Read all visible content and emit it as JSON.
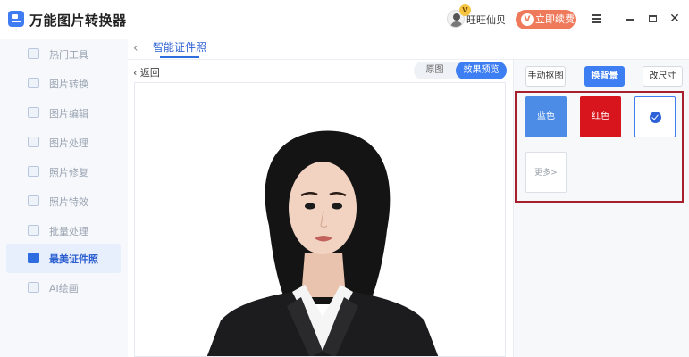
{
  "app": {
    "title": "万能图片转换器"
  },
  "header": {
    "vip_badge": "V",
    "user_name": "旺旺仙贝",
    "renew_label": "立即续费",
    "renew_icon": "V"
  },
  "sidebar": {
    "items": [
      {
        "label": "热门工具",
        "icon": "hot-tools-icon",
        "active": false
      },
      {
        "label": "图片转换",
        "icon": "image-convert-icon",
        "active": false
      },
      {
        "label": "图片编辑",
        "icon": "image-edit-icon",
        "active": false
      },
      {
        "label": "图片处理",
        "icon": "image-process-icon",
        "active": false
      },
      {
        "label": "照片修复",
        "icon": "photo-repair-icon",
        "active": false
      },
      {
        "label": "照片特效",
        "icon": "photo-effects-icon",
        "active": false
      },
      {
        "label": "批量处理",
        "icon": "batch-icon",
        "active": false
      },
      {
        "label": "最美证件照",
        "icon": "id-photo-icon",
        "active": true
      },
      {
        "label": "AI绘画",
        "icon": "ai-paint-icon",
        "active": false
      }
    ]
  },
  "tabs": {
    "active_label": "智能证件照"
  },
  "preview": {
    "back_label": "返回",
    "toggle_original": "原图",
    "toggle_preview": "效果预览"
  },
  "right_panel": {
    "manual_cutout": "手动抠图",
    "change_background": "换背景",
    "change_size": "改尺寸",
    "colors": {
      "blue": "蓝色",
      "red": "红色",
      "more": "更多>"
    }
  },
  "accent": {
    "primary": "#3d7ef2",
    "highlight_border": "#a71f2d",
    "red_swatch": "#d8151c",
    "blue_swatch": "#4c8ce6"
  }
}
